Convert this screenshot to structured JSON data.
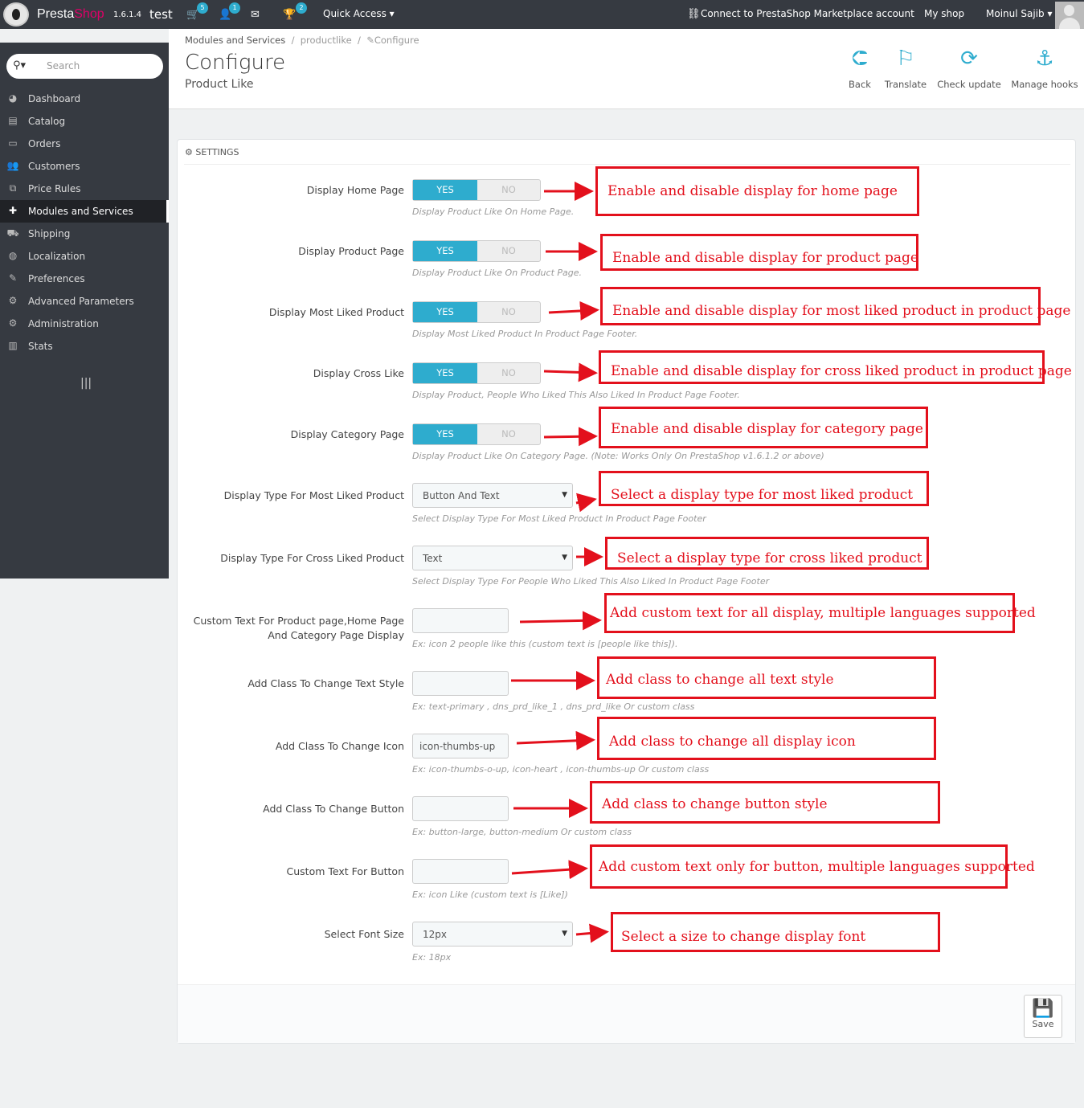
{
  "topbar": {
    "brand_presta": "Presta",
    "brand_shop": "Shop",
    "version": "1.6.1.4",
    "shop_name": "test",
    "orders_badge": "5",
    "customers_badge": "1",
    "trophy_badge": "2",
    "quick_access": "Quick Access ▾",
    "marketplace": "Connect to PrestaShop Marketplace account",
    "my_shop": "My shop",
    "user": "Moinul Sajib ▾"
  },
  "sidebar": {
    "search_placeholder": "Search",
    "items": [
      {
        "label": "Dashboard",
        "icon": "dashboard-icon"
      },
      {
        "label": "Catalog",
        "icon": "book-icon"
      },
      {
        "label": "Orders",
        "icon": "credit-card-icon"
      },
      {
        "label": "Customers",
        "icon": "users-icon"
      },
      {
        "label": "Price Rules",
        "icon": "tags-icon"
      },
      {
        "label": "Modules and Services",
        "icon": "puzzle-icon"
      },
      {
        "label": "Shipping",
        "icon": "truck-icon"
      },
      {
        "label": "Localization",
        "icon": "globe-icon"
      },
      {
        "label": "Preferences",
        "icon": "wrench-icon"
      },
      {
        "label": "Advanced Parameters",
        "icon": "cogs-icon"
      },
      {
        "label": "Administration",
        "icon": "cog-icon"
      },
      {
        "label": "Stats",
        "icon": "bar-chart-icon"
      }
    ],
    "active_index": 5
  },
  "header": {
    "breadcrumb_1": "Modules and Services",
    "breadcrumb_sep": "/",
    "breadcrumb_2": "productlike",
    "breadcrumb_3": "Configure",
    "title": "Configure",
    "subtitle": "Product Like",
    "toolbar": {
      "back": "Back",
      "translate": "Translate",
      "check_update": "Check update",
      "manage_hooks": "Manage hooks"
    }
  },
  "panel": {
    "heading": "SETTINGS",
    "save": "Save",
    "switch_yes": "YES",
    "switch_no": "NO",
    "fields": {
      "home": {
        "label": "Display Home Page",
        "help": "Display Product Like On Home Page.",
        "value": "YES"
      },
      "product": {
        "label": "Display Product Page",
        "help": "Display Product Like On Product Page.",
        "value": "YES"
      },
      "most_liked": {
        "label": "Display Most Liked Product",
        "help": "Display Most Liked Product In Product Page Footer.",
        "value": "YES"
      },
      "cross_like": {
        "label": "Display Cross Like",
        "help": "Display Product, People Who Liked This Also Liked In Product Page Footer.",
        "value": "YES"
      },
      "category": {
        "label": "Display Category Page",
        "help": "Display Product Like On Category Page. (Note: Works Only On PrestaShop v1.6.1.2 or above)",
        "value": "YES"
      },
      "type_most": {
        "label": "Display Type For Most Liked Product",
        "value": "Button And Text",
        "help": "Select Display Type For Most Liked Product In Product Page Footer"
      },
      "type_cross": {
        "label": "Display Type For Cross Liked Product",
        "value": "Text",
        "help": "Select Display Type For People Who Liked This Also Liked In Product Page Footer"
      },
      "custom_text": {
        "label_1": "Custom Text For Product page,Home Page",
        "label_2": "And Category Page Display",
        "value": "",
        "help": "Ex: icon 2 people like this (custom text is [people like this])."
      },
      "text_class": {
        "label": "Add Class To Change Text Style",
        "value": "",
        "help": "Ex: text-primary , dns_prd_like_1 , dns_prd_like Or custom class"
      },
      "icon_class": {
        "label": "Add Class To Change Icon",
        "value": "icon-thumbs-up",
        "help": "Ex: icon-thumbs-o-up, icon-heart , icon-thumbs-up Or custom class"
      },
      "button_class": {
        "label": "Add Class To Change Button",
        "value": "",
        "help": "Ex: button-large, button-medium Or custom class"
      },
      "button_text": {
        "label": "Custom Text For Button",
        "value": "",
        "help": "Ex: icon Like (custom text is [Like])"
      },
      "font_size": {
        "label": "Select Font Size",
        "value": "12px",
        "help": "Ex: 18px"
      }
    }
  },
  "annotations": {
    "home": "Enable and disable display for home page",
    "product": "Enable and disable display for product page",
    "most_liked": "Enable and disable display for most liked product in product page",
    "cross_like": "Enable and disable display for cross liked product in product page",
    "category": "Enable and disable display for category page",
    "type_most": "Select a display type for most liked product",
    "type_cross": "Select a display type for cross liked product",
    "custom_text": "Add custom text for all display, multiple languages supported",
    "text_class": "Add class to change all text style",
    "icon_class": "Add class to change all display icon",
    "button_class": "Add class to change button style",
    "button_text": "Add custom text only for button, multiple languages supported",
    "font_size": "Select a size to change display font",
    "color": "#e3101c"
  }
}
